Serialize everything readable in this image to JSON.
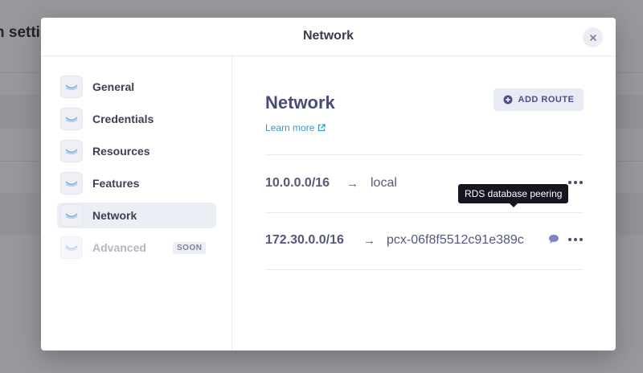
{
  "background": {
    "title": "n setti"
  },
  "modal": {
    "title": "Network",
    "close_icon": "close-icon"
  },
  "sidebar": {
    "items": [
      {
        "label": "General",
        "icon": "wave-icon",
        "active": false,
        "disabled": false
      },
      {
        "label": "Credentials",
        "icon": "wave-icon",
        "active": false,
        "disabled": false
      },
      {
        "label": "Resources",
        "icon": "wave-icon",
        "active": false,
        "disabled": false
      },
      {
        "label": "Features",
        "icon": "wave-icon",
        "active": false,
        "disabled": false
      },
      {
        "label": "Network",
        "icon": "wave-icon",
        "active": true,
        "disabled": false
      },
      {
        "label": "Advanced",
        "icon": "wave-icon",
        "active": false,
        "disabled": true,
        "badge": "SOON"
      }
    ]
  },
  "content": {
    "title": "Network",
    "learn_more": "Learn more",
    "add_route_label": "ADD ROUTE",
    "routes": [
      {
        "cidr": "10.0.0.0/16",
        "arrow": "→",
        "target": "local"
      },
      {
        "cidr": "172.30.0.0/16",
        "arrow": "→",
        "target": "pcx-06f8f5512c91e389c",
        "comment": "RDS database peering"
      }
    ]
  },
  "colors": {
    "accent": "#4a4d73",
    "link": "#2e9bd6",
    "tooltip_bg": "#15161f"
  }
}
